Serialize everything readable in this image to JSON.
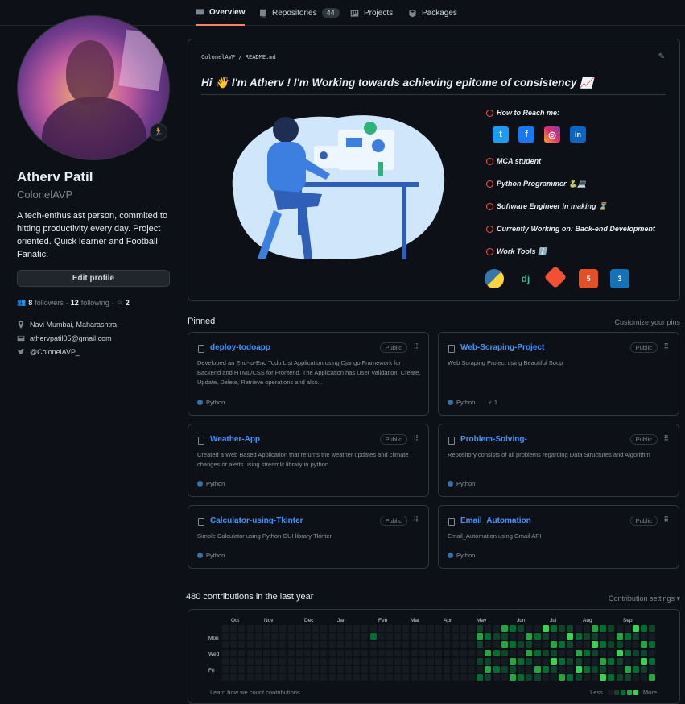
{
  "tabs": [
    {
      "label": "Overview",
      "active": true
    },
    {
      "label": "Repositories",
      "count": "44"
    },
    {
      "label": "Projects"
    },
    {
      "label": "Packages"
    }
  ],
  "profile": {
    "fullname": "Atherv Patil",
    "username": "ColonelAVP",
    "bio": "A tech-enthusiast person, commited to hitting productivity every day. Project oriented. Quick learner and Football Fanatic.",
    "edit_label": "Edit profile",
    "followers_count": "8",
    "followers_label": "followers",
    "following_count": "12",
    "following_label": "following",
    "stars_count": "2",
    "location": "Navi Mumbai, Maharashtra",
    "email": "athervpatil05@gmail.com",
    "twitter": "@ColonelAVP_"
  },
  "readme": {
    "path": "ColonelAVP / README.md",
    "headline": "Hi 👋 I'm Atherv !   I'm Working towards achieving epitome of consistency 📈",
    "items": [
      "How to Reach me:",
      "MCA student",
      "Python Programmer 🐍💻",
      "Software Engineer in making ⏳",
      "Currently Working on: Back-end Development",
      "Work Tools ℹ️"
    ],
    "social_icons": [
      "twitter-icon",
      "facebook-icon",
      "instagram-icon",
      "linkedin-icon"
    ],
    "tool_icons": [
      "python-icon",
      "django-icon",
      "git-icon",
      "html5-icon",
      "css3-icon"
    ],
    "tool_glyphs": [
      "",
      "dj",
      "",
      "5",
      "3"
    ]
  },
  "pinned": {
    "title": "Pinned",
    "customize": "Customize your pins",
    "visibility": "Public",
    "repos": [
      {
        "name": "deploy-todoapp",
        "desc": "Developed an End-to-End Todo List Application using Django Framework for Backend and HTML/CSS for Frontend. The Application has User Validation, Create, Update, Delete, Retrieve operations and also...",
        "lang": "Python"
      },
      {
        "name": "Web-Scraping-Project",
        "desc": "Web Scraping Project using Beautiful Soup",
        "lang": "Python",
        "forks": "1"
      },
      {
        "name": "Weather-App",
        "desc": "Created a Web Based Application that returns the weather updates and climate changes or alerts using streamlit library in python",
        "lang": "Python"
      },
      {
        "name": "Problem-Solving-",
        "desc": "Repository consists of all problems regarding Data Structures and Algorithm",
        "lang": "Python"
      },
      {
        "name": "Calculator-using-Tkinter",
        "desc": "Simple Calculator using Python GUI library Tkinter",
        "lang": "Python"
      },
      {
        "name": "Email_Automation",
        "desc": "Email_Automation using Gmail API",
        "lang": "Python"
      }
    ]
  },
  "contributions": {
    "title": "480 contributions in the last year",
    "settings": "Contribution settings ▾",
    "months": [
      "Oct",
      "Nov",
      "Dec",
      "Jan",
      "Feb",
      "Mar",
      "Apr",
      "May",
      "Jun",
      "Jul",
      "Aug",
      "Sep"
    ],
    "days": [
      "Mon",
      "Wed",
      "Fri"
    ],
    "learn": "Learn how we count contributions",
    "less": "Less",
    "more": "More",
    "colors": [
      "#161b22",
      "#0e4429",
      "#006d32",
      "#26a641",
      "#39d353"
    ]
  }
}
